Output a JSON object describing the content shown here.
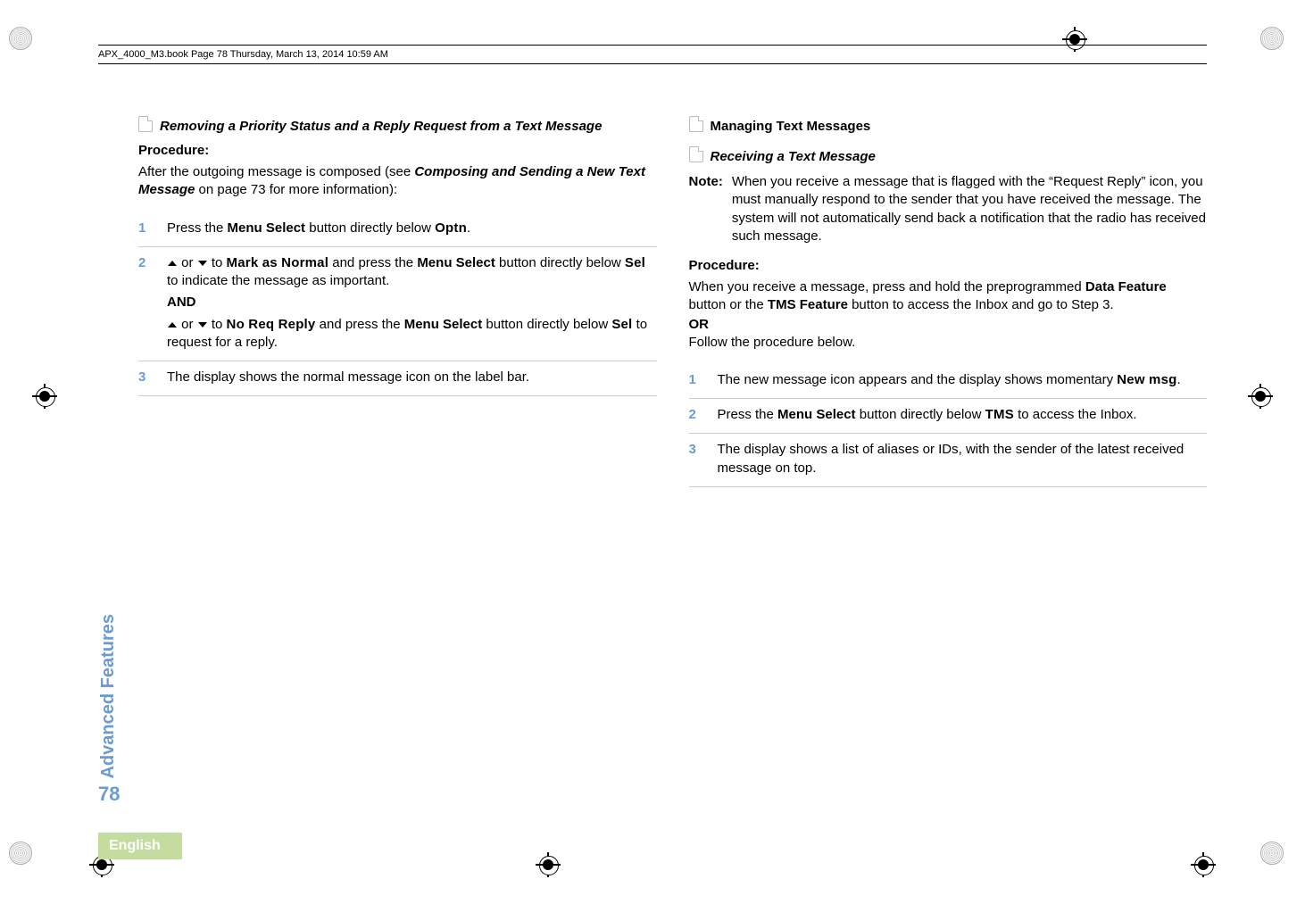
{
  "header": {
    "runhead": "APX_4000_M3.book  Page 78  Thursday, March 13, 2014  10:59 AM"
  },
  "side": {
    "section_label": "Advanced Features",
    "page_number": "78",
    "language": "English"
  },
  "left": {
    "heading": "Removing a Priority Status and a Reply Request from a Text Message",
    "procedure_label": "Procedure:",
    "intro_a": "After the outgoing message is composed (see ",
    "intro_b": "Composing and Sending a New Text Message",
    "intro_c": " on page 73 for more information):",
    "steps": {
      "s1_a": "Press the ",
      "s1_b": "Menu Select",
      "s1_c": " button directly below ",
      "s1_d": "Optn",
      "s1_e": ".",
      "s2_a": " or ",
      "s2_b": " to ",
      "s2_c": "Mark as Normal",
      "s2_d": " and press the ",
      "s2_e": "Menu Select",
      "s2_f": " button directly below ",
      "s2_g": "Sel",
      "s2_h": " to indicate the message as important.",
      "s2_and": "AND",
      "s2_i": " or ",
      "s2_j": " to ",
      "s2_k": "No Req Reply",
      "s2_l": " and press the ",
      "s2_m": "Menu Select",
      "s2_n": " button directly below ",
      "s2_o": "Sel",
      "s2_p": " to request for a reply.",
      "s3": "The display shows the normal message icon on the label bar."
    }
  },
  "right": {
    "section": "Managing Text Messages",
    "heading": "Receiving a Text Message",
    "note_label": "Note:",
    "note_text": "When you receive a message that is flagged with the “Request Reply” icon, you must manually respond to the sender that you have received the message. The system will not automatically send back a notification that the radio has received such message.",
    "procedure_label": "Procedure:",
    "proc_intro_a": "When you receive a message, press and hold the preprogrammed ",
    "proc_intro_b": "Data Feature",
    "proc_intro_c": " button or the ",
    "proc_intro_d": "TMS Feature",
    "proc_intro_e": " button to access the Inbox and go to Step 3.",
    "or_label": "OR",
    "or_text": "Follow the procedure below.",
    "steps": {
      "s1_a": "The new message icon appears and the display shows momentary ",
      "s1_b": "New msg",
      "s1_c": ".",
      "s2_a": "Press the ",
      "s2_b": "Menu Select",
      "s2_c": " button directly below ",
      "s2_d": "TMS",
      "s2_e": " to access the Inbox.",
      "s3": "The display shows a list of aliases or IDs, with the sender of the latest received message on top."
    }
  }
}
